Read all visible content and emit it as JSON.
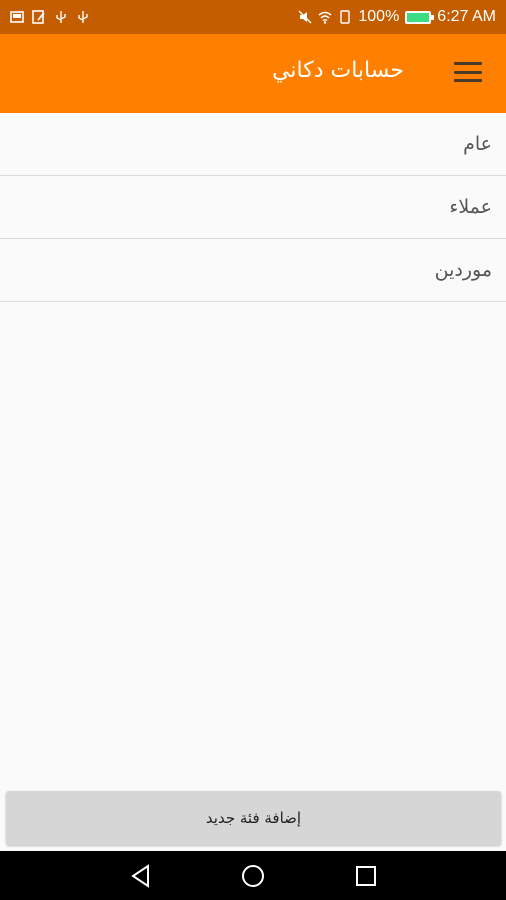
{
  "status_bar": {
    "battery_percent": "100%",
    "time": "6:27 AM",
    "left_icons": [
      "screenshot-icon",
      "edit-icon",
      "usb-icon",
      "usb-icon"
    ],
    "right_icons": [
      "mute-icon",
      "wifi-icon",
      "sim-icon",
      "battery-icon"
    ],
    "background_color": "#c45c00"
  },
  "app_bar": {
    "title": "حسابات دكاني",
    "menu_icon": "hamburger-menu-icon",
    "background_color": "#ff8000"
  },
  "categories": [
    {
      "label": "عام"
    },
    {
      "label": "عملاء"
    },
    {
      "label": "موردين"
    }
  ],
  "add_button": {
    "label": "إضافة فئة جديد"
  },
  "nav_bar": {
    "buttons": [
      "back-icon",
      "home-icon",
      "recents-icon"
    ]
  }
}
